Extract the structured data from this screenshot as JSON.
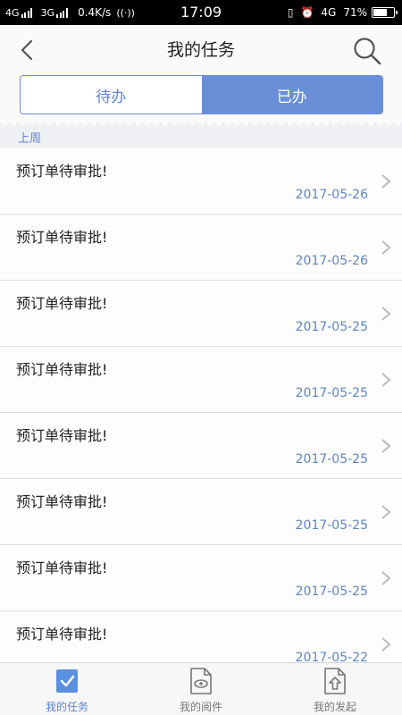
{
  "status_bar": {
    "network1": "4G",
    "network2": "3G",
    "speed": "0.4K/s",
    "time": "17:09",
    "network3": "4G",
    "battery": "71%",
    "battery_level": 0.71
  },
  "header": {
    "title": "我的任务",
    "back_icon": "chevron-left-icon",
    "search_icon": "search-icon"
  },
  "tabs": [
    {
      "label": "待办",
      "active": false
    },
    {
      "label": "已办",
      "active": true
    }
  ],
  "section": {
    "label": "上周"
  },
  "items": [
    {
      "title": "预订单待审批!",
      "date": "2017-05-26"
    },
    {
      "title": "预订单待审批!",
      "date": "2017-05-26"
    },
    {
      "title": "预订单待审批!",
      "date": "2017-05-25"
    },
    {
      "title": "预订单待审批!",
      "date": "2017-05-25"
    },
    {
      "title": "预订单待审批!",
      "date": "2017-05-25"
    },
    {
      "title": "预订单待审批!",
      "date": "2017-05-25"
    },
    {
      "title": "预订单待审批!",
      "date": "2017-05-25"
    },
    {
      "title": "预订单待审批!",
      "date": "2017-05-22"
    }
  ],
  "bottom_nav": [
    {
      "label": "我的任务",
      "icon": "task-check-icon",
      "active": true
    },
    {
      "label": "我的阅件",
      "icon": "document-eye-icon",
      "active": false
    },
    {
      "label": "我的发起",
      "icon": "document-send-icon",
      "active": false
    }
  ],
  "colors": {
    "accent": "#6a8fd8",
    "date": "#5a86c7",
    "status_bar": "#000000"
  }
}
